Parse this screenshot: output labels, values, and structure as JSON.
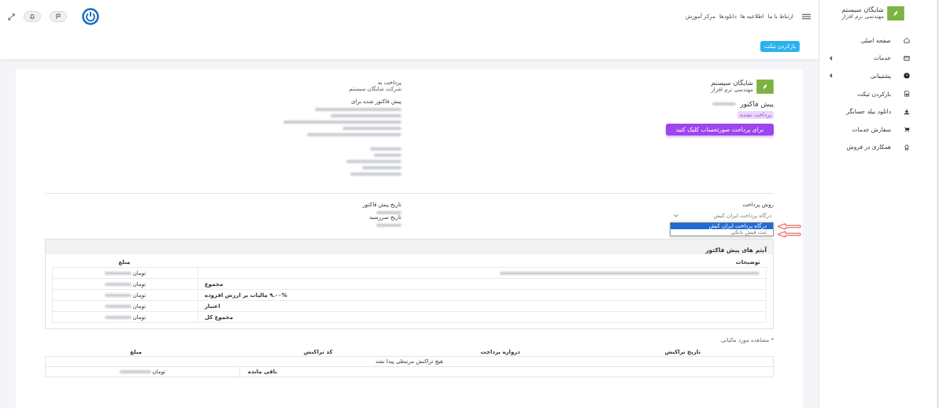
{
  "sidebar": {
    "brand": {
      "name": "شایگان سیستم",
      "tagline": "مهندسی نرم افزار"
    },
    "items": [
      {
        "label": "صفحه اصلی",
        "kind": "home",
        "has_submenu": false
      },
      {
        "label": "خدمات",
        "kind": "card",
        "has_submenu": true
      },
      {
        "label": "پشتیبانی",
        "kind": "help",
        "has_submenu": true
      },
      {
        "label": "بازکردن تیکت",
        "kind": "file",
        "has_submenu": false
      },
      {
        "label": "دانلود بیلد حسابگر",
        "kind": "download",
        "has_submenu": false
      },
      {
        "label": "سفارش خدمات",
        "kind": "cart",
        "has_submenu": false
      },
      {
        "label": "همکاری در فروش",
        "kind": "award",
        "has_submenu": false
      }
    ]
  },
  "header": {
    "links": [
      "ارتباط با ما",
      "اطلاعیه ها",
      "دانلودها",
      "مرکز آموزش"
    ],
    "ticket_button": "بازکردن تیکت"
  },
  "invoice": {
    "brand": {
      "name": "شایگان سیستم",
      "tagline": "مهندسی نرم افزار"
    },
    "title": "پیش فاکتور",
    "status": "پرداخت نشده",
    "pay_button": "برای پرداخت صورتحساب کلیک کنید",
    "pay_to": {
      "label": "پرداخت به",
      "company": "شرکت شایگان سیستم"
    },
    "invoiced_to": {
      "label": "پیش فاکتور شده برای"
    },
    "payment_method": {
      "label": "روش پرداخت",
      "value": "درگاه پرداخت ایران کیش",
      "options": [
        {
          "label": "درگاه پرداخت ایران کیش",
          "selected": true
        },
        {
          "label": "ثبت فیش بانکی",
          "selected": false
        }
      ]
    },
    "dates": [
      {
        "label": "تاریخ پیش فاکتور"
      },
      {
        "label": "تاریخ سررسید"
      }
    ]
  },
  "items": {
    "title": "آیتم های پیش فاکتور",
    "columns": [
      "توضیحات",
      "مبلغ"
    ],
    "rows": [
      {
        "kind": "item",
        "currency": "تومان"
      },
      {
        "kind": "summary",
        "label": "مجموع",
        "currency": "تومان"
      },
      {
        "kind": "summary",
        "label": "۹.۰۰% مالیات بر ارزش افزوده",
        "currency": "تومان"
      },
      {
        "kind": "summary",
        "label": "اعتبار",
        "currency": "تومان"
      },
      {
        "kind": "summary",
        "label": "مجموع کل",
        "currency": "تومان"
      }
    ]
  },
  "tax_note": "* مشاهده مورد مالیاتی",
  "transactions": {
    "columns": [
      "تاریخ تراکنش",
      "دروازه پرداخت",
      "کد تراکنش",
      "مبلغ"
    ],
    "empty_message": "هیچ تراکنش مرتبطی پیدا نشد",
    "balance": {
      "label": "باقی مانده",
      "currency": "تومان"
    }
  }
}
